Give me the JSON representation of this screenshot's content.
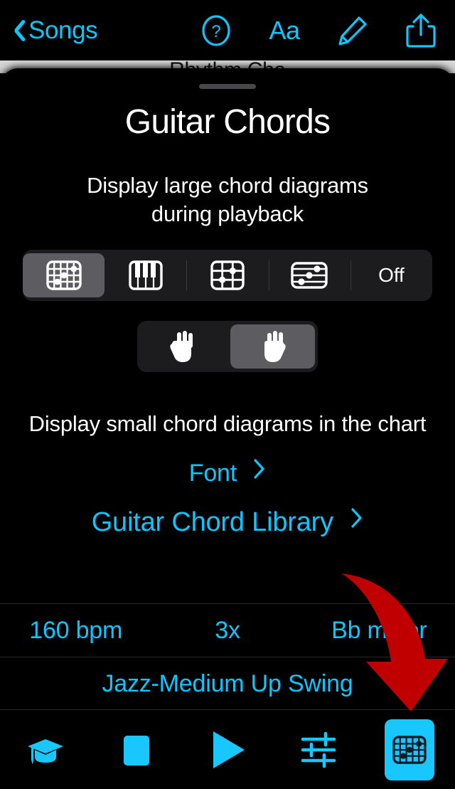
{
  "navbar": {
    "back_label": "Songs",
    "back_icon": "chevron-left-icon",
    "actions": [
      {
        "name": "help-button",
        "icon": "question-circle-icon",
        "label": "?"
      },
      {
        "name": "text-size-button",
        "icon": "text-size-icon",
        "label": "Aa"
      },
      {
        "name": "edit-button",
        "icon": "pencil-icon",
        "label": ""
      },
      {
        "name": "share-button",
        "icon": "share-icon",
        "label": ""
      }
    ]
  },
  "behind_sheet": {
    "obscured_title": "Rhythm Cha"
  },
  "sheet": {
    "grabber": "sheet-grabber",
    "title": "Guitar Chords",
    "subtitle": "Display large chord diagrams\nduring playback",
    "segmented_control": {
      "name": "chord-diagram-type-segmented-control",
      "options": [
        {
          "label": "",
          "icon": "guitar-chord-diagram-icon",
          "selected": true
        },
        {
          "label": "",
          "icon": "piano-keys-icon",
          "selected": false
        },
        {
          "label": "",
          "icon": "ukulele-chord-diagram-icon",
          "selected": false
        },
        {
          "label": "",
          "icon": "notation-staff-icon",
          "selected": false
        },
        {
          "label": "Off",
          "icon": "",
          "selected": false
        }
      ]
    },
    "hand_control": {
      "name": "handedness-segmented-control",
      "options": [
        {
          "icon": "left-hand-icon",
          "selected": false
        },
        {
          "icon": "right-hand-icon",
          "selected": true
        }
      ]
    },
    "small_chords_note": "Display small chord diagrams in the chart",
    "font_link": {
      "label": "Font",
      "chevron": "chevron-right-icon"
    },
    "library_link": {
      "label": "Guitar Chord Library",
      "chevron": "chevron-right-icon"
    }
  },
  "info": {
    "row1": [
      "160 bpm",
      "3x",
      "Bb major"
    ],
    "row2": [
      "Jazz-Medium Up Swing"
    ]
  },
  "tabbar": {
    "items": [
      {
        "name": "tab-learn",
        "icon": "graduation-cap-icon",
        "active": false
      },
      {
        "name": "tab-stop",
        "icon": "stop-square-icon",
        "active": false
      },
      {
        "name": "tab-play",
        "icon": "play-triangle-icon",
        "active": false
      },
      {
        "name": "tab-mixer",
        "icon": "sliders-icon",
        "active": false
      },
      {
        "name": "tab-chords",
        "icon": "guitar-chord-diagram-icon",
        "active": true
      }
    ]
  },
  "annotation": {
    "arrow": "red-curved-down-arrow",
    "color": "#c00000"
  },
  "colors": {
    "accent": "#0ac8ff",
    "background": "#000000",
    "control_bg": "#1c1c1e",
    "control_selected": "#5d5d61",
    "annotation_red": "#c00000",
    "text": "#ffffff"
  }
}
